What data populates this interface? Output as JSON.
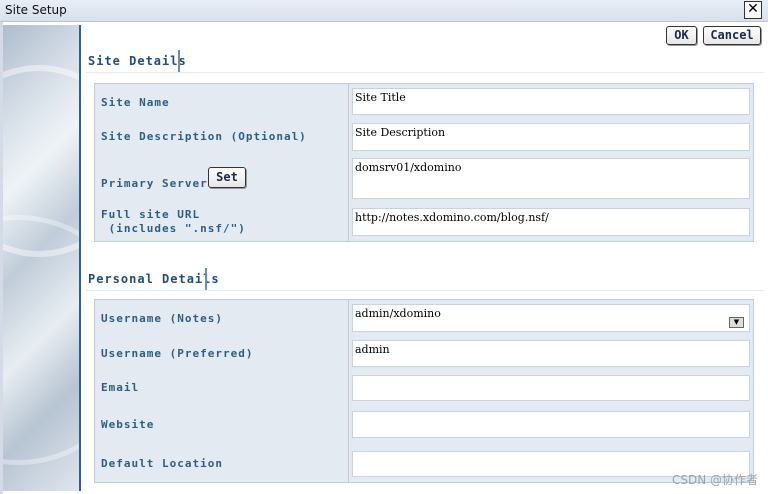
{
  "window": {
    "title": "Site Setup",
    "close_glyph": "✕"
  },
  "buttons": {
    "ok": "OK",
    "cancel": "Cancel",
    "set": "Set"
  },
  "site_details": {
    "heading": "Site Details",
    "site_name_label": "Site Name",
    "site_name_value": "Site Title",
    "site_desc_label": "Site Description (Optional)",
    "site_desc_value": "Site Description",
    "primary_server_label": "Primary Server",
    "primary_server_value": "domsrv01/xdomino",
    "full_url_label": "Full site URL\n (includes \".nsf/\")",
    "full_url_value": "http://notes.xdomino.com/blog.nsf/"
  },
  "personal_details": {
    "heading": "Personal Details",
    "username_notes_label": "Username (Notes)",
    "username_notes_value": "admin/xdomino",
    "username_pref_label": "Username (Preferred)",
    "username_pref_value": "admin",
    "email_label": "Email",
    "email_value": "",
    "website_label": "Website",
    "website_value": "",
    "location_label": "Default Location",
    "location_value": ""
  },
  "watermark": "CSDN @协作者"
}
